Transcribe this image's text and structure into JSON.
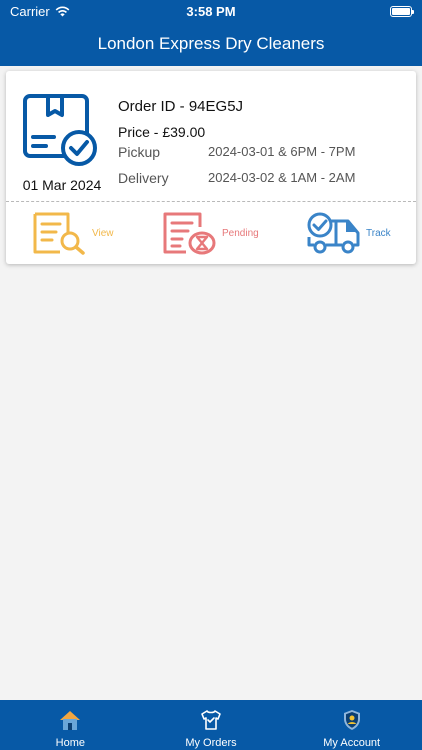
{
  "status_bar": {
    "carrier": "Carrier",
    "time": "3:58 PM"
  },
  "header": {
    "title": "London Express Dry Cleaners"
  },
  "orders": [
    {
      "date": "01 Mar 2024",
      "order_id": "Order ID - 94EG5J",
      "price": "Price - £39.00",
      "pickup_label": "Pickup",
      "pickup_value": "2024-03-01 & 6PM - 7PM",
      "delivery_label": "Delivery",
      "delivery_value": "2024-03-02 & 1AM - 2AM",
      "actions": {
        "view": "View",
        "status": "Pending",
        "track": "Track"
      }
    }
  ],
  "bottom_nav": {
    "items": [
      {
        "label": "Home",
        "icon": "home-icon"
      },
      {
        "label": "My Orders",
        "icon": "orders-shirt-icon"
      },
      {
        "label": "My Account",
        "icon": "account-shield-icon"
      }
    ]
  },
  "colors": {
    "brand": "#0759a6",
    "view": "#f2b84a",
    "pending": "#e7787a",
    "track": "#3a84c8"
  }
}
